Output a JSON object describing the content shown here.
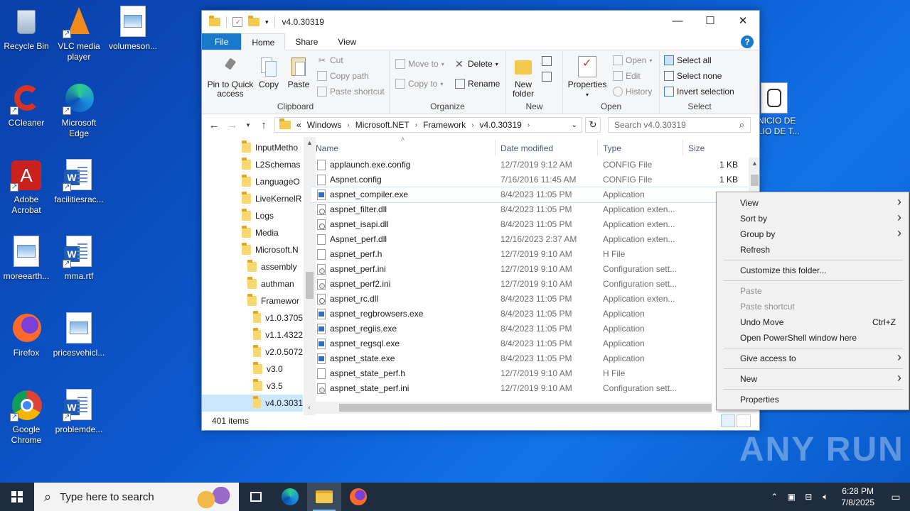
{
  "desktop": {
    "icons": [
      {
        "label": "Recycle Bin",
        "icon": "recycle-bin-icon"
      },
      {
        "label": "VLC media player",
        "icon": "vlc-icon"
      },
      {
        "label": "volumeson...",
        "icon": "image-file-icon"
      },
      {
        "label": "CCleaner",
        "icon": "ccleaner-icon"
      },
      {
        "label": "Microsoft Edge",
        "icon": "edge-icon"
      },
      {
        "label": "Adobe Acrobat",
        "icon": "acrobat-icon"
      },
      {
        "label": "facilitiesrac...",
        "icon": "word-doc-icon"
      },
      {
        "label": "moreearth...",
        "icon": "image-file-icon"
      },
      {
        "label": "mma.rtf",
        "icon": "word-doc-icon"
      },
      {
        "label": "Firefox",
        "icon": "firefox-icon"
      },
      {
        "label": "pricesvehicl...",
        "icon": "image-file-icon"
      },
      {
        "label": "Google Chrome",
        "icon": "chrome-icon"
      },
      {
        "label": "problemde...",
        "icon": "word-doc-icon"
      }
    ],
    "partial_icon_label": "NICIO DE\nLIO DE T..."
  },
  "explorer": {
    "title": "v4.0.30319",
    "tabs": [
      "File",
      "Home",
      "Share",
      "View"
    ],
    "ribbon": {
      "clipboard": {
        "group": "Clipboard",
        "pin": "Pin to Quick access",
        "copy": "Copy",
        "paste": "Paste",
        "cut": "Cut",
        "copy_path": "Copy path",
        "paste_shortcut": "Paste shortcut"
      },
      "organize": {
        "group": "Organize",
        "move_to": "Move to",
        "copy_to": "Copy to",
        "delete": "Delete",
        "rename": "Rename"
      },
      "new": {
        "group": "New",
        "new_folder": "New folder"
      },
      "open": {
        "group": "Open",
        "properties": "Properties",
        "open": "Open",
        "edit": "Edit",
        "history": "History"
      },
      "select": {
        "group": "Select",
        "select_all": "Select all",
        "select_none": "Select none",
        "invert": "Invert selection"
      }
    },
    "address": {
      "crumbs": [
        "«",
        "Windows",
        "Microsoft.NET",
        "Framework",
        "v4.0.30319"
      ],
      "search_placeholder": "Search v4.0.30319"
    },
    "nav_items": [
      {
        "label": "InputMetho",
        "indent": 0
      },
      {
        "label": "L2Schemas",
        "indent": 0
      },
      {
        "label": "LanguageO",
        "indent": 0
      },
      {
        "label": "LiveKernelR",
        "indent": 0
      },
      {
        "label": "Logs",
        "indent": 0
      },
      {
        "label": "Media",
        "indent": 0
      },
      {
        "label": "Microsoft.N",
        "indent": 0
      },
      {
        "label": "assembly",
        "indent": 1
      },
      {
        "label": "authman",
        "indent": 1
      },
      {
        "label": "Framewor",
        "indent": 1
      },
      {
        "label": "v1.0.3705",
        "indent": 2
      },
      {
        "label": "v1.1.4322",
        "indent": 2
      },
      {
        "label": "v2.0.5072",
        "indent": 2
      },
      {
        "label": "v3.0",
        "indent": 2
      },
      {
        "label": "v3.5",
        "indent": 2
      },
      {
        "label": "v4.0.3031",
        "indent": 2,
        "selected": true
      }
    ],
    "columns": [
      "Name",
      "Date modified",
      "Type",
      "Size"
    ],
    "files": [
      {
        "name": "applaunch.exe.config",
        "date": "12/7/2019 9:12 AM",
        "type": "CONFIG File",
        "size": "1 KB",
        "icon": "file"
      },
      {
        "name": "Aspnet.config",
        "date": "7/16/2016 11:45 AM",
        "type": "CONFIG File",
        "size": "1 KB",
        "icon": "file"
      },
      {
        "name": "aspnet_compiler.exe",
        "date": "8/4/2023 11:05 PM",
        "type": "Application",
        "size": "",
        "icon": "app"
      },
      {
        "name": "aspnet_filter.dll",
        "date": "8/4/2023 11:05 PM",
        "type": "Application exten...",
        "size": "",
        "icon": "dll"
      },
      {
        "name": "aspnet_isapi.dll",
        "date": "8/4/2023 11:05 PM",
        "type": "Application exten...",
        "size": "",
        "icon": "dll"
      },
      {
        "name": "Aspnet_perf.dll",
        "date": "12/16/2023 2:37 AM",
        "type": "Application exten...",
        "size": "",
        "icon": "file"
      },
      {
        "name": "aspnet_perf.h",
        "date": "12/7/2019 9:10 AM",
        "type": "H File",
        "size": "",
        "icon": "file"
      },
      {
        "name": "aspnet_perf.ini",
        "date": "12/7/2019 9:10 AM",
        "type": "Configuration sett...",
        "size": "",
        "icon": "ini"
      },
      {
        "name": "aspnet_perf2.ini",
        "date": "12/7/2019 9:10 AM",
        "type": "Configuration sett...",
        "size": "",
        "icon": "ini"
      },
      {
        "name": "aspnet_rc.dll",
        "date": "8/4/2023 11:05 PM",
        "type": "Application exten...",
        "size": "",
        "icon": "dll"
      },
      {
        "name": "aspnet_regbrowsers.exe",
        "date": "8/4/2023 11:05 PM",
        "type": "Application",
        "size": "",
        "icon": "app"
      },
      {
        "name": "aspnet_regiis.exe",
        "date": "8/4/2023 11:05 PM",
        "type": "Application",
        "size": "",
        "icon": "app"
      },
      {
        "name": "aspnet_regsql.exe",
        "date": "8/4/2023 11:05 PM",
        "type": "Application",
        "size": "",
        "icon": "app"
      },
      {
        "name": "aspnet_state.exe",
        "date": "8/4/2023 11:05 PM",
        "type": "Application",
        "size": "",
        "icon": "app"
      },
      {
        "name": "aspnet_state_perf.h",
        "date": "12/7/2019 9:10 AM",
        "type": "H File",
        "size": "",
        "icon": "file"
      },
      {
        "name": "aspnet_state_perf.ini",
        "date": "12/7/2019 9:10 AM",
        "type": "Configuration sett...",
        "size": "",
        "icon": "ini"
      }
    ],
    "status": "401 items"
  },
  "context_menu": {
    "items": [
      {
        "label": "View",
        "submenu": true
      },
      {
        "label": "Sort by",
        "submenu": true
      },
      {
        "label": "Group by",
        "submenu": true
      },
      {
        "label": "Refresh"
      },
      {
        "sep": true
      },
      {
        "label": "Customize this folder..."
      },
      {
        "sep": true
      },
      {
        "label": "Paste",
        "disabled": true
      },
      {
        "label": "Paste shortcut",
        "disabled": true
      },
      {
        "label": "Undo Move",
        "shortcut": "Ctrl+Z"
      },
      {
        "label": "Open PowerShell window here"
      },
      {
        "sep": true
      },
      {
        "label": "Give access to",
        "submenu": true
      },
      {
        "sep": true
      },
      {
        "label": "New",
        "submenu": true
      },
      {
        "sep": true
      },
      {
        "label": "Properties"
      }
    ]
  },
  "taskbar": {
    "search_placeholder": "Type here to search",
    "time": "6:28 PM",
    "date": "7/8/2025",
    "apps": [
      "task-view-icon",
      "edge-icon",
      "file-explorer-icon",
      "firefox-icon"
    ]
  },
  "watermark": "ANY RUN"
}
